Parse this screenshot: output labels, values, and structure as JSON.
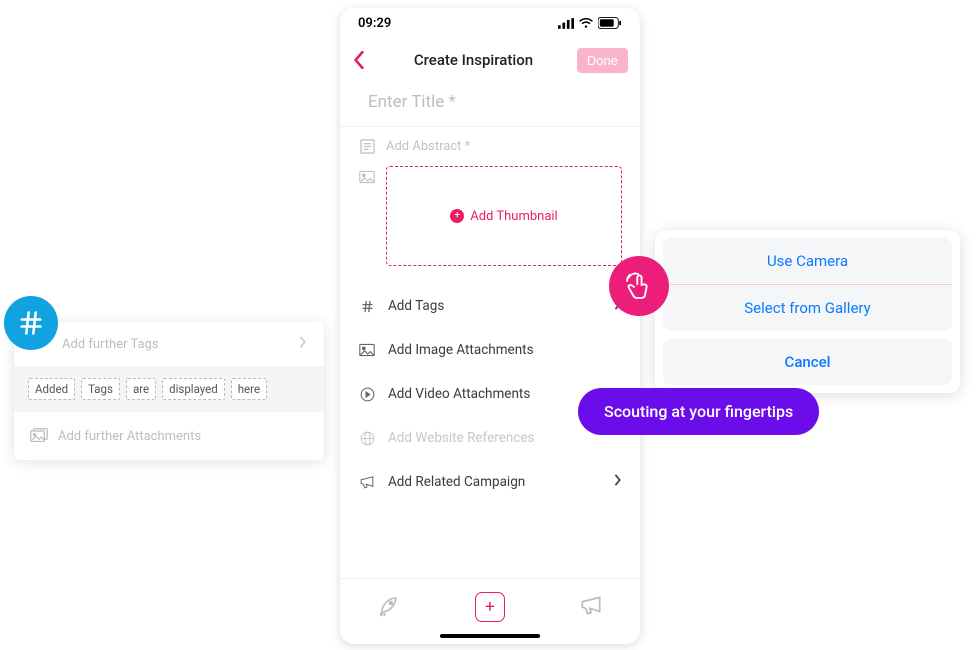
{
  "status": {
    "time": "09:29"
  },
  "nav": {
    "title": "Create Inspiration",
    "done": "Done"
  },
  "form": {
    "title_placeholder": "Enter Title  *",
    "abstract_placeholder": "Add Abstract  *",
    "thumbnail_label": "Add Thumbnail"
  },
  "options": {
    "tags": "Add Tags",
    "images": "Add Image Attachments",
    "videos": "Add Video Attachments",
    "website": "Add  Website References",
    "campaign": "Add Related Campaign"
  },
  "tags_panel": {
    "header": "Add further Tags",
    "chips": [
      "Added",
      "Tags",
      "are",
      "displayed",
      "here"
    ],
    "attachments": "Add further Attachments"
  },
  "sheet": {
    "camera": "Use Camera",
    "gallery": "Select from Gallery",
    "cancel": "Cancel"
  },
  "toast": "Scouting at your fingertips"
}
